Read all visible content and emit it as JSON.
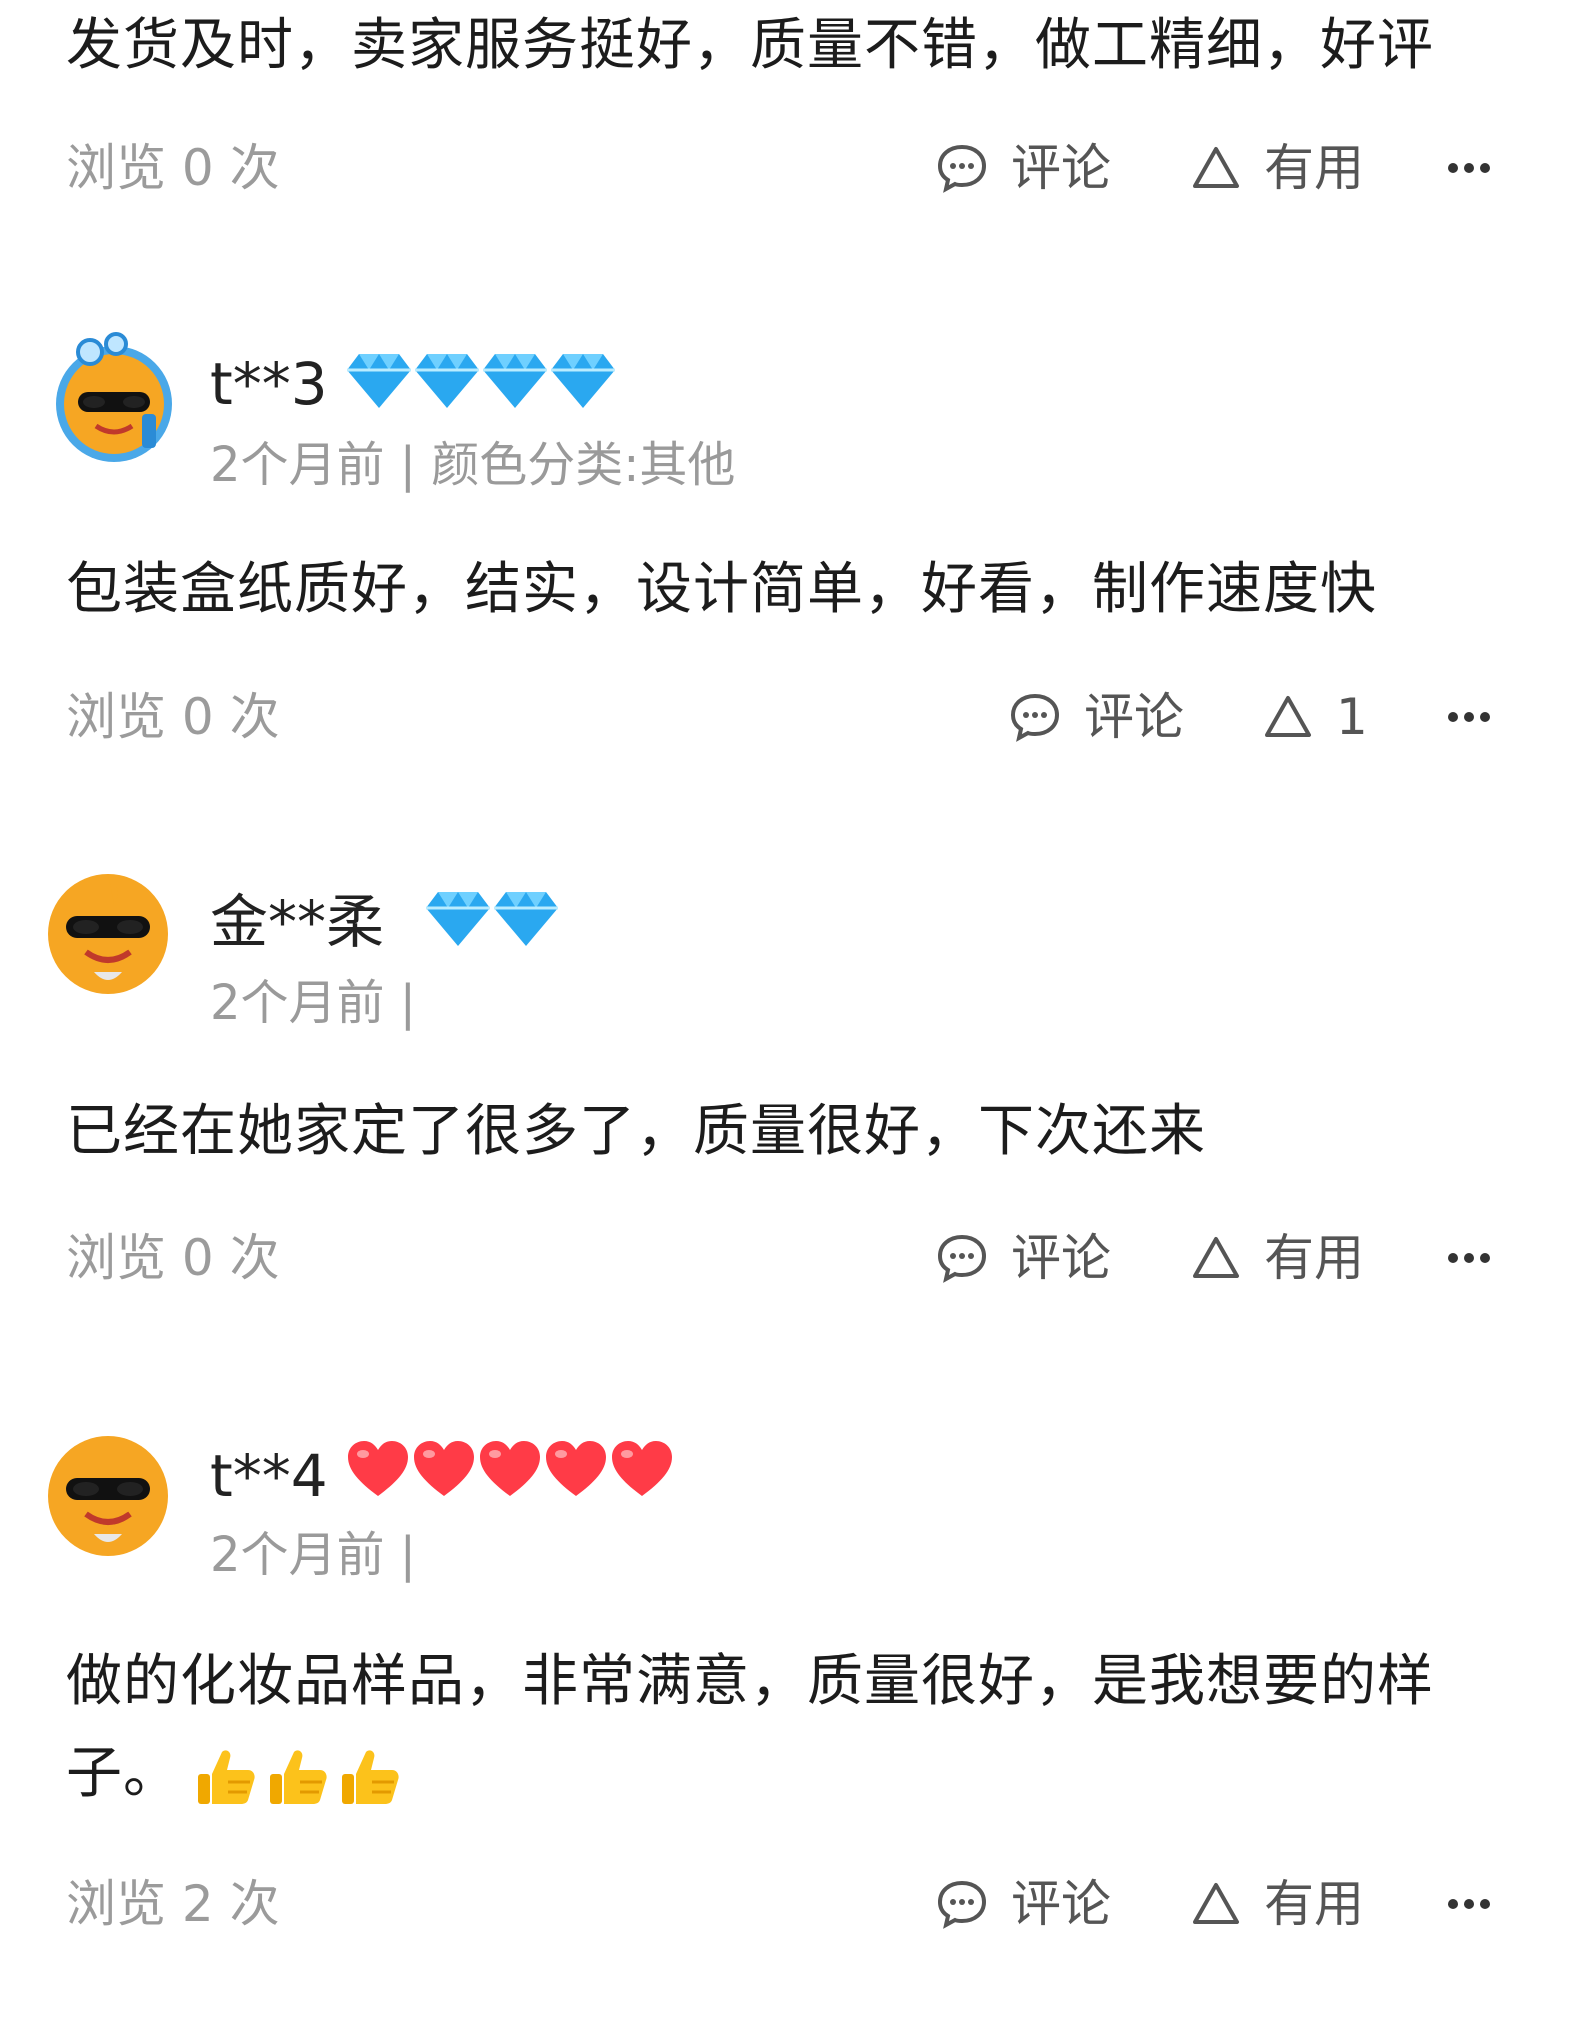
{
  "reviews": [
    {
      "text": "发货及时，卖家服务挺好，质量不错，做工精细，好评",
      "views": "浏览 0 次",
      "comment_label": "评论",
      "useful_label": "有用"
    },
    {
      "username": "t**3",
      "badge_type": "diamond",
      "badge_count": 4,
      "subtitle": "2个月前 | 颜色分类:其他",
      "text": "包装盒纸质好，结实，设计简单，好看，制作速度快",
      "views": "浏览 0 次",
      "comment_label": "评论",
      "useful_label": "1"
    },
    {
      "username": "金**柔",
      "badge_type": "diamond",
      "badge_count": 2,
      "subtitle": "2个月前 |",
      "text": "已经在她家定了很多了，质量很好，下次还来",
      "views": "浏览 0 次",
      "comment_label": "评论",
      "useful_label": "有用"
    },
    {
      "username": "t**4",
      "badge_type": "heart",
      "badge_count": 5,
      "subtitle": "2个月前 |",
      "text_line1": "做的化妆品样品，非常满意，质量很好，是我想要的样",
      "text_line2": "子。",
      "emojis": [
        "thumbs-up",
        "thumbs-up",
        "thumbs-up"
      ],
      "views": "浏览 2 次",
      "comment_label": "评论",
      "useful_label": "有用"
    }
  ],
  "colors": {
    "diamond": "#2aa8f0",
    "heart": "#ff3b47",
    "muted_text": "#9b9b9b",
    "avatar_orange": "#f6a623"
  }
}
